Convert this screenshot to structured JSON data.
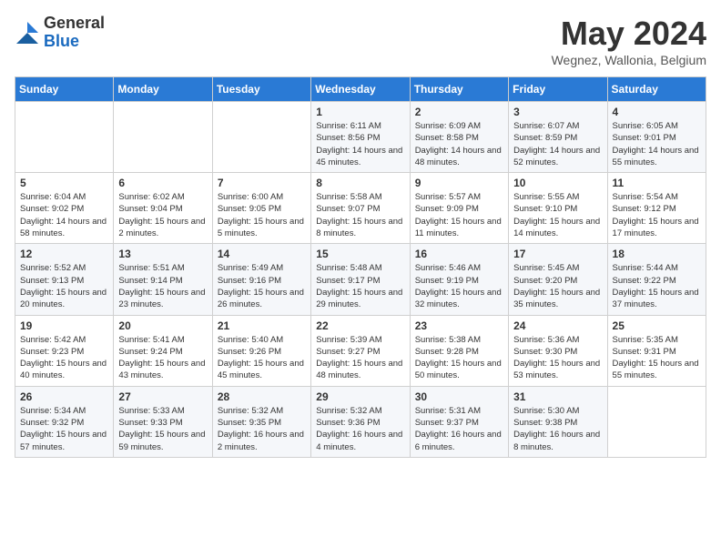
{
  "logo": {
    "general": "General",
    "blue": "Blue"
  },
  "title": {
    "month_year": "May 2024",
    "location": "Wegnez, Wallonia, Belgium"
  },
  "weekdays": [
    "Sunday",
    "Monday",
    "Tuesday",
    "Wednesday",
    "Thursday",
    "Friday",
    "Saturday"
  ],
  "weeks": [
    [
      {
        "day": "",
        "info": ""
      },
      {
        "day": "",
        "info": ""
      },
      {
        "day": "",
        "info": ""
      },
      {
        "day": "1",
        "info": "Sunrise: 6:11 AM\nSunset: 8:56 PM\nDaylight: 14 hours and 45 minutes."
      },
      {
        "day": "2",
        "info": "Sunrise: 6:09 AM\nSunset: 8:58 PM\nDaylight: 14 hours and 48 minutes."
      },
      {
        "day": "3",
        "info": "Sunrise: 6:07 AM\nSunset: 8:59 PM\nDaylight: 14 hours and 52 minutes."
      },
      {
        "day": "4",
        "info": "Sunrise: 6:05 AM\nSunset: 9:01 PM\nDaylight: 14 hours and 55 minutes."
      }
    ],
    [
      {
        "day": "5",
        "info": "Sunrise: 6:04 AM\nSunset: 9:02 PM\nDaylight: 14 hours and 58 minutes."
      },
      {
        "day": "6",
        "info": "Sunrise: 6:02 AM\nSunset: 9:04 PM\nDaylight: 15 hours and 2 minutes."
      },
      {
        "day": "7",
        "info": "Sunrise: 6:00 AM\nSunset: 9:05 PM\nDaylight: 15 hours and 5 minutes."
      },
      {
        "day": "8",
        "info": "Sunrise: 5:58 AM\nSunset: 9:07 PM\nDaylight: 15 hours and 8 minutes."
      },
      {
        "day": "9",
        "info": "Sunrise: 5:57 AM\nSunset: 9:09 PM\nDaylight: 15 hours and 11 minutes."
      },
      {
        "day": "10",
        "info": "Sunrise: 5:55 AM\nSunset: 9:10 PM\nDaylight: 15 hours and 14 minutes."
      },
      {
        "day": "11",
        "info": "Sunrise: 5:54 AM\nSunset: 9:12 PM\nDaylight: 15 hours and 17 minutes."
      }
    ],
    [
      {
        "day": "12",
        "info": "Sunrise: 5:52 AM\nSunset: 9:13 PM\nDaylight: 15 hours and 20 minutes."
      },
      {
        "day": "13",
        "info": "Sunrise: 5:51 AM\nSunset: 9:14 PM\nDaylight: 15 hours and 23 minutes."
      },
      {
        "day": "14",
        "info": "Sunrise: 5:49 AM\nSunset: 9:16 PM\nDaylight: 15 hours and 26 minutes."
      },
      {
        "day": "15",
        "info": "Sunrise: 5:48 AM\nSunset: 9:17 PM\nDaylight: 15 hours and 29 minutes."
      },
      {
        "day": "16",
        "info": "Sunrise: 5:46 AM\nSunset: 9:19 PM\nDaylight: 15 hours and 32 minutes."
      },
      {
        "day": "17",
        "info": "Sunrise: 5:45 AM\nSunset: 9:20 PM\nDaylight: 15 hours and 35 minutes."
      },
      {
        "day": "18",
        "info": "Sunrise: 5:44 AM\nSunset: 9:22 PM\nDaylight: 15 hours and 37 minutes."
      }
    ],
    [
      {
        "day": "19",
        "info": "Sunrise: 5:42 AM\nSunset: 9:23 PM\nDaylight: 15 hours and 40 minutes."
      },
      {
        "day": "20",
        "info": "Sunrise: 5:41 AM\nSunset: 9:24 PM\nDaylight: 15 hours and 43 minutes."
      },
      {
        "day": "21",
        "info": "Sunrise: 5:40 AM\nSunset: 9:26 PM\nDaylight: 15 hours and 45 minutes."
      },
      {
        "day": "22",
        "info": "Sunrise: 5:39 AM\nSunset: 9:27 PM\nDaylight: 15 hours and 48 minutes."
      },
      {
        "day": "23",
        "info": "Sunrise: 5:38 AM\nSunset: 9:28 PM\nDaylight: 15 hours and 50 minutes."
      },
      {
        "day": "24",
        "info": "Sunrise: 5:36 AM\nSunset: 9:30 PM\nDaylight: 15 hours and 53 minutes."
      },
      {
        "day": "25",
        "info": "Sunrise: 5:35 AM\nSunset: 9:31 PM\nDaylight: 15 hours and 55 minutes."
      }
    ],
    [
      {
        "day": "26",
        "info": "Sunrise: 5:34 AM\nSunset: 9:32 PM\nDaylight: 15 hours and 57 minutes."
      },
      {
        "day": "27",
        "info": "Sunrise: 5:33 AM\nSunset: 9:33 PM\nDaylight: 15 hours and 59 minutes."
      },
      {
        "day": "28",
        "info": "Sunrise: 5:32 AM\nSunset: 9:35 PM\nDaylight: 16 hours and 2 minutes."
      },
      {
        "day": "29",
        "info": "Sunrise: 5:32 AM\nSunset: 9:36 PM\nDaylight: 16 hours and 4 minutes."
      },
      {
        "day": "30",
        "info": "Sunrise: 5:31 AM\nSunset: 9:37 PM\nDaylight: 16 hours and 6 minutes."
      },
      {
        "day": "31",
        "info": "Sunrise: 5:30 AM\nSunset: 9:38 PM\nDaylight: 16 hours and 8 minutes."
      },
      {
        "day": "",
        "info": ""
      }
    ]
  ]
}
